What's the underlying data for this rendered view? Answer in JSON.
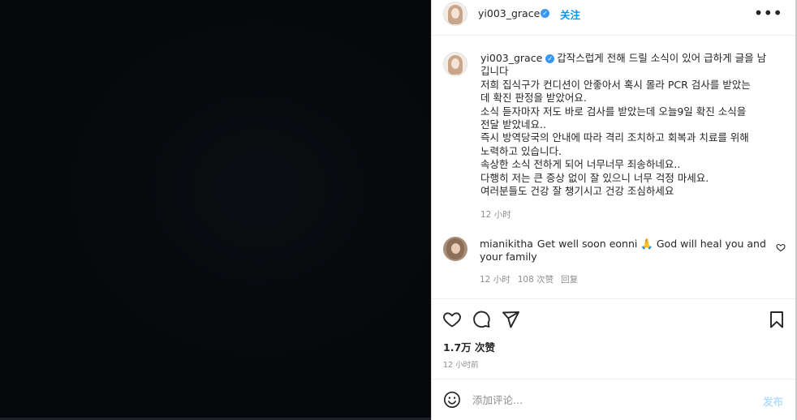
{
  "header": {
    "username": "yi003_grace",
    "follow_label": "关注",
    "more_label": "•••"
  },
  "caption": {
    "username": "yi003_grace",
    "lines": [
      "갑작스럽게 전해 드릴 소식이 있어 급하게 글을 남",
      "깁니다",
      "저희 집식구가 컨디션이 안좋아서 혹시 몰라 PCR 검사를 받았는",
      "데 확진 판정을 받았어요.",
      "소식 듣자마자 저도 바로 검사를 받았는데 오늘9일 확진 소식을",
      "전달 받았네요..",
      "즉시 방역당국의 안내에 따라 격리 조치하고 회복과 치료를 위해",
      "노력하고 있습니다.",
      "속상한 소식 전하게 되어 너무너무 죄송하네요..",
      "다행히 저는 큰 증상 없이 잘 있으니 너무 걱정 마세요.",
      "여러분들도 건강 잘 챙기시고 건강 조심하세요"
    ],
    "time": "12 小时"
  },
  "comment": {
    "username": "mianikitha",
    "line1": "Get well soon eonni 🙏 God will heal you and",
    "line2": "your family",
    "time": "12 小时",
    "likes": "108 次赞",
    "reply_label": "回复"
  },
  "actions": {
    "icons": [
      "heart-icon",
      "comment-icon",
      "share-icon",
      "bookmark-icon"
    ]
  },
  "stats": {
    "likes": "1.7万 次赞",
    "posted": "12 小时前"
  },
  "composer": {
    "placeholder": "添加评论...",
    "post_label": "发布"
  },
  "colors": {
    "accent": "#0095f6",
    "post_disabled": "#b2dffc",
    "verified": "#3897f0",
    "media_bg": "#07080c",
    "muted": "#8e8e8e"
  }
}
